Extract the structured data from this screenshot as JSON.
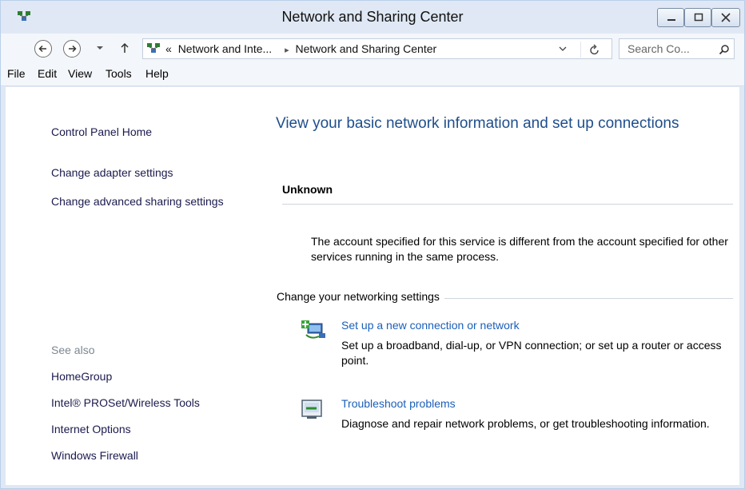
{
  "window": {
    "title": "Network and Sharing Center"
  },
  "address_bar": {
    "breadcrumb": [
      "Network and Inte...",
      "Network and Sharing Center"
    ],
    "breadcrumb_prefix": "«",
    "separator": "▸",
    "search_placeholder": "Search Co..."
  },
  "menu": {
    "items": [
      "File",
      "Edit",
      "View",
      "Tools",
      "Help"
    ]
  },
  "left_pane": {
    "links": [
      "Control Panel Home",
      "Change adapter settings",
      "Change advanced sharing settings"
    ],
    "see_also_label": "See also",
    "see_also_links": [
      "HomeGroup",
      "Intel® PROSet/Wireless Tools",
      "Internet Options",
      "Windows Firewall"
    ]
  },
  "main": {
    "title": "View your basic network information and set up connections",
    "network_name": "Unknown",
    "status_message": "The account specified for this service is different from the account specified for other services running in the same process.",
    "section_label": "Change your networking settings",
    "tasks": [
      {
        "icon": "new-connection-icon",
        "link": "Set up a new connection or network",
        "description": "Set up a broadband, dial-up, or VPN connection; or set up a router or access point."
      },
      {
        "icon": "troubleshoot-icon",
        "link": "Troubleshoot problems",
        "description": "Diagnose and repair network problems, or get troubleshooting information."
      }
    ]
  },
  "colors": {
    "title_link_blue": "#1e4e8c",
    "task_link_blue": "#1b5fb8",
    "frame": "#dfe8f4"
  }
}
